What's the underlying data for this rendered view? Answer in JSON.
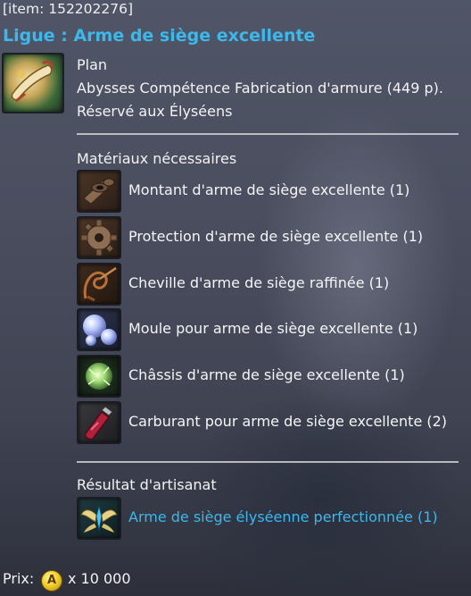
{
  "item_id": "[item: 152202276]",
  "title": "Ligue : Arme de siège excellente",
  "plan": {
    "icon": "scroll-plan-icon",
    "type": "Plan",
    "skill": "Abysses Compétence Fabrication d'armure (449 p).",
    "restriction": "Réservé aux Élyséens"
  },
  "materials": {
    "heading": "Matériaux nécessaires",
    "items": [
      {
        "icon": "siege-upright-icon",
        "label": "Montant d'arme de siège excellente (1)"
      },
      {
        "icon": "siege-gear-icon",
        "label": "Protection d'arme de siège excellente (1)"
      },
      {
        "icon": "siege-rope-icon",
        "label": "Cheville d'arme de siège raffinée (1)"
      },
      {
        "icon": "mold-orbs-icon",
        "label": "Moule pour arme de siège excellente (1)"
      },
      {
        "icon": "chassis-orb-icon",
        "label": "Châssis d'arme de siège excellente (1)"
      },
      {
        "icon": "fuel-bottle-icon",
        "label": "Carburant pour arme de siège excellente (2)"
      }
    ]
  },
  "result": {
    "heading": "Résultat d'artisanat",
    "icon": "winged-emblem-icon",
    "label": "Arme de siège élyséenne perfectionnée (1)"
  },
  "price": {
    "label": "Prix:",
    "currency_icon": "abyss-coin-icon",
    "currency_letter": "A",
    "amount": "x 10 000"
  },
  "colors": {
    "title": "#3cb8ec",
    "result": "#3cb8ec",
    "text": "#f3f3f3"
  }
}
